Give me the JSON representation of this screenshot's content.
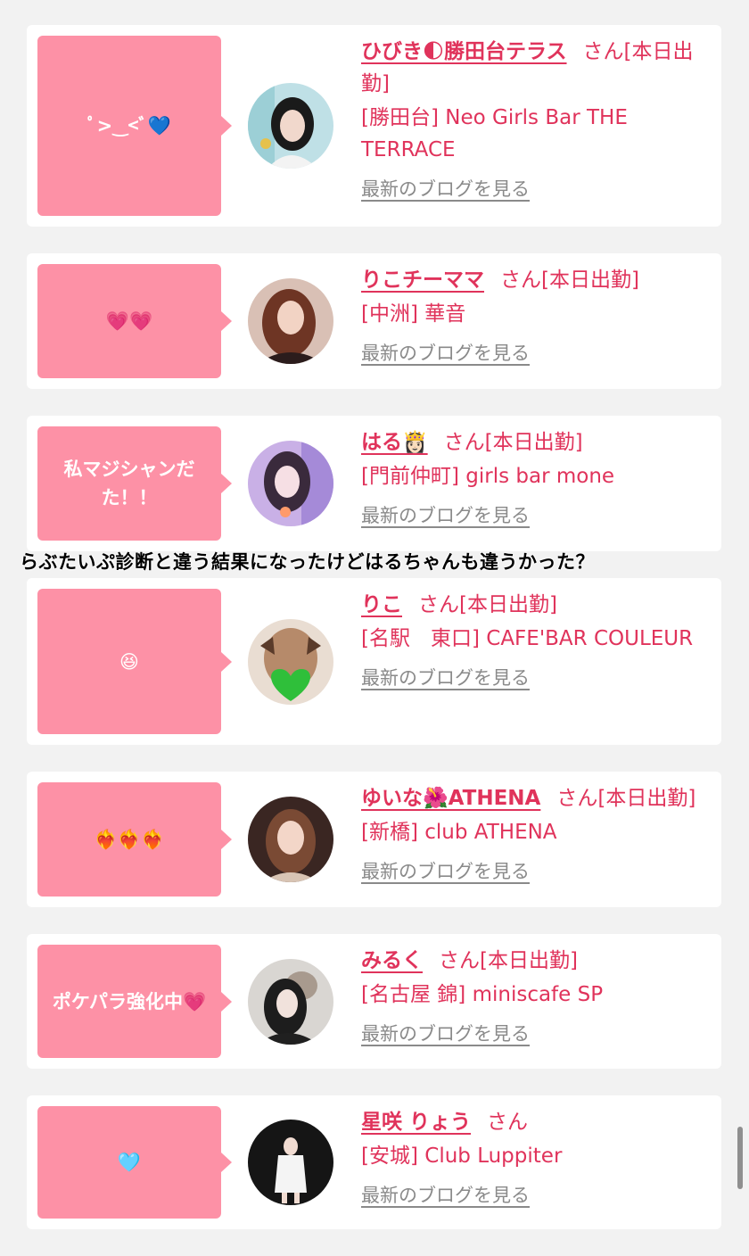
{
  "cards": [
    {
      "bubble": "ﾟ>‿<ﾞ💙",
      "name": "ひびき🌓勝田台テラス",
      "san": "さん[本日出勤]",
      "shop": "[勝田台] Neo Girls Bar THE TERRACE",
      "blog": "最新のブログを見る"
    },
    {
      "bubble": "💗💗",
      "name": "りこチーママ",
      "san": "さん[本日出勤]",
      "shop": "[中洲] 華音",
      "blog": "最新のブログを見る"
    },
    {
      "bubble": "私マジシャンだた！！",
      "name": "はる👸🏻",
      "san": "さん[本日出勤]",
      "shop": "[門前仲町] girls bar mone",
      "blog": "最新のブログを見る"
    },
    {
      "bubble": "😆",
      "name": "りこ",
      "san": "さん[本日出勤]",
      "shop": "[名駅　東口] CAFE'BAR COULEUR",
      "blog": "最新のブログを見る"
    },
    {
      "bubble": "❤️‍🔥❤️‍🔥❤️‍🔥",
      "name": "ゆいな🌺ATHENA",
      "san": "さん[本日出勤]",
      "shop": "[新橋] club ATHENA",
      "blog": "最新のブログを見る"
    },
    {
      "bubble": "ポケパラ強化中💗",
      "name": "みるく",
      "san": "さん[本日出勤]",
      "shop": "[名古屋 錦] miniscafe SP",
      "blog": "最新のブログを見る"
    },
    {
      "bubble": "🩵",
      "name": "星咲 りょう",
      "san": "さん",
      "shop": "[安城] Club Luppiter",
      "blog": "最新のブログを見る"
    }
  ],
  "caption": "らぶたいぷ診断と違う結果になったけどはるちゃんも違うかった？",
  "colors": {
    "accent": "#e0335b",
    "bubble": "#fd91a6",
    "background": "#f2f2f2"
  }
}
